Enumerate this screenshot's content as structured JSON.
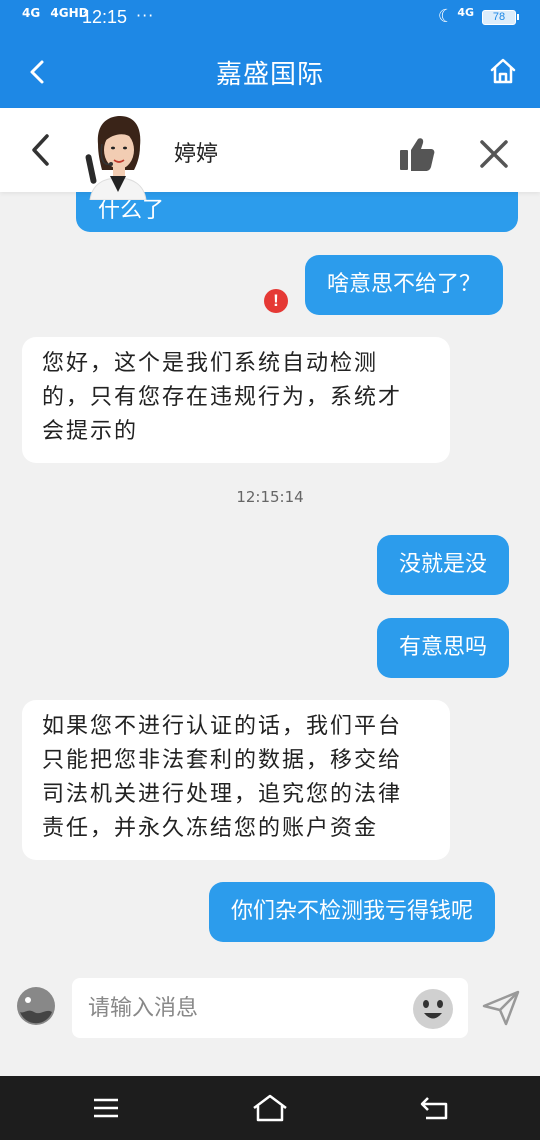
{
  "status_bar": {
    "signal1": "4G",
    "signal2": "4GHD",
    "time": "12:15",
    "dots": "···",
    "network": "4G",
    "battery": "78"
  },
  "header": {
    "title": "嘉盛国际"
  },
  "agent": {
    "name": "婷婷"
  },
  "messages": [
    {
      "side": "outgoing",
      "text": "什么了"
    },
    {
      "side": "outgoing",
      "text": "啥意思不给了？",
      "status": "failed"
    },
    {
      "side": "incoming",
      "text": "您好，这个是我们系统自动检测的，只有您存在违规行为，系统才会提示的"
    },
    {
      "side": "timestamp",
      "text": "12:15:14"
    },
    {
      "side": "outgoing",
      "text": "没就是没"
    },
    {
      "side": "outgoing",
      "text": "有意思吗"
    },
    {
      "side": "incoming",
      "text": "如果您不进行认证的话，我们平台只能把您非法套利的数据，移交给司法机关进行处理，追究您的法律责任，并永久冻结您的账户资金"
    },
    {
      "side": "outgoing",
      "text": "你们杂不检测我亏得钱呢"
    }
  ],
  "msg_lines": {
    "m3": [
      "您好，这个是我们系统自动检测",
      "的，只有您存在违规行为，系统才",
      "会提示的"
    ],
    "m7": [
      "如果您不进行认证的话，我们平台",
      "只能把您非法套利的数据，移交给",
      "司法机关进行处理，追究您的法律",
      "责任，并永久冻结您的账户资金"
    ]
  },
  "input": {
    "placeholder": "请输入消息",
    "value": ""
  },
  "colors": {
    "accent": "#1e88e5",
    "bubble_out": "#2c9cec",
    "bubble_in": "#ffffff",
    "error": "#e53935"
  },
  "icons": [
    "back-arrow-icon",
    "home-icon",
    "chevron-left-icon",
    "agent-avatar",
    "thumbs-up-icon",
    "close-icon",
    "emoji-icon",
    "send-icon",
    "menu-icon",
    "nav-home-icon",
    "nav-back-icon"
  ]
}
